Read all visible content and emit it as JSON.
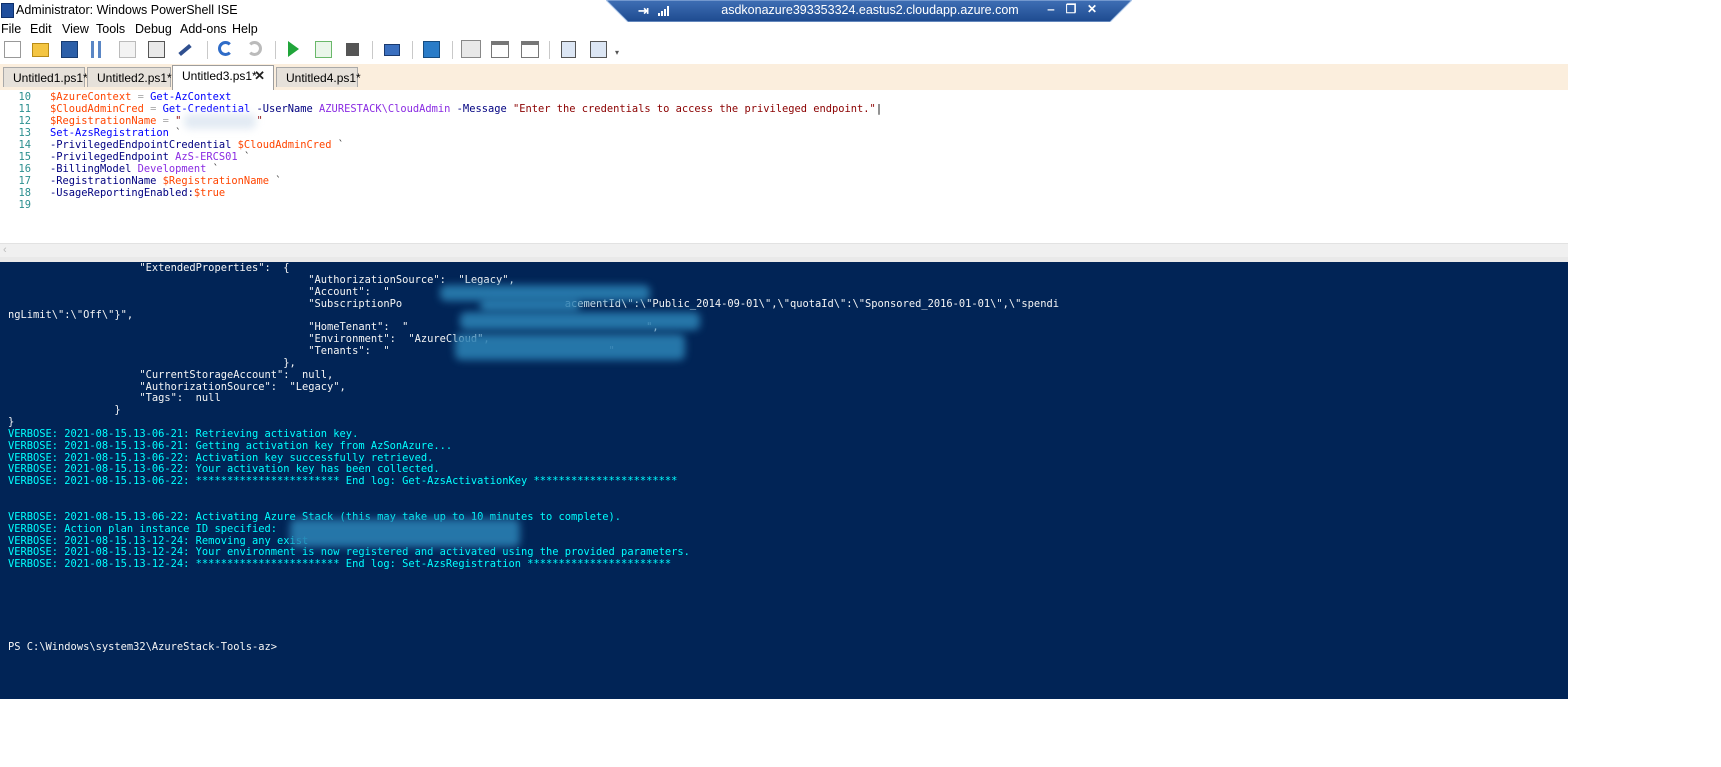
{
  "window": {
    "title": "Administrator: Windows PowerShell ISE"
  },
  "rdp_bar": {
    "host": "asdkonazure393353324.eastus2.cloudapp.azure.com",
    "pin_icon": "pin-icon",
    "signal_icon": "signal-strength-icon",
    "minimize_icon": "minimize-icon",
    "restore_icon": "restore-icon",
    "close_icon": "close-icon"
  },
  "menu": [
    "File",
    "Edit",
    "View",
    "Tools",
    "Debug",
    "Add-ons",
    "Help"
  ],
  "toolbar": {
    "icons": [
      "new-icon",
      "open-icon",
      "save-icon",
      "cut-icon",
      "copy-icon",
      "paste-icon",
      "clear-icon",
      "undo-icon",
      "redo-icon",
      "run-icon",
      "run-selection-icon",
      "stop-icon",
      "remote-powershell-icon",
      "powershell-icon",
      "show-script-pane-top-icon",
      "show-script-pane-right-icon",
      "show-script-pane-maximized-icon",
      "show-command-window-icon",
      "show-command-addon-icon",
      "toolbar-overflow-icon"
    ]
  },
  "tabs": [
    {
      "label": "Untitled1.ps1*",
      "active": false
    },
    {
      "label": "Untitled2.ps1*",
      "active": false
    },
    {
      "label": "Untitled3.ps1*",
      "active": true,
      "close": "✕"
    },
    {
      "label": "Untitled4.ps1*",
      "active": false
    }
  ],
  "editor": {
    "lines": [
      {
        "n": "10",
        "tokens": [
          [
            "var",
            "$AzureContext"
          ],
          [
            "op",
            " = "
          ],
          [
            "cmd",
            "Get-AzContext"
          ]
        ]
      },
      {
        "n": "11",
        "tokens": [
          [
            "var",
            "$CloudAdminCred"
          ],
          [
            "op",
            " = "
          ],
          [
            "cmd",
            "Get-Credential"
          ],
          [
            "param",
            " -UserName "
          ],
          [
            "plain",
            "AZURESTACK\\CloudAdmin"
          ],
          [
            "param",
            " -Message "
          ],
          [
            "str",
            "\"Enter the credentials to access the privileged endpoint.\""
          ],
          [
            "txt",
            "|"
          ]
        ]
      },
      {
        "n": "12",
        "tokens": [
          [
            "var",
            "$RegistrationName"
          ],
          [
            "op",
            " = "
          ],
          [
            "str",
            "\"            \""
          ]
        ]
      },
      {
        "n": "13",
        "tokens": [
          [
            "cmd",
            "Set-AzsRegistration"
          ],
          [
            "bt",
            " `"
          ]
        ]
      },
      {
        "n": "14",
        "tokens": [
          [
            "param",
            "-PrivilegedEndpointCredential "
          ],
          [
            "var",
            "$CloudAdminCred"
          ],
          [
            "bt",
            " `"
          ]
        ]
      },
      {
        "n": "15",
        "tokens": [
          [
            "param",
            "-PrivilegedEndpoint "
          ],
          [
            "plain",
            "AzS-ERCS01"
          ],
          [
            "bt",
            " `"
          ]
        ]
      },
      {
        "n": "16",
        "tokens": [
          [
            "param",
            "-BillingModel "
          ],
          [
            "plain",
            "Development"
          ],
          [
            "bt",
            " `"
          ]
        ]
      },
      {
        "n": "17",
        "tokens": [
          [
            "param",
            "-RegistrationName "
          ],
          [
            "var",
            "$RegistrationName"
          ],
          [
            "bt",
            " `"
          ]
        ]
      },
      {
        "n": "18",
        "tokens": [
          [
            "param",
            "-UsageReportingEnabled:"
          ],
          [
            "var",
            "$true"
          ]
        ]
      },
      {
        "n": "19",
        "tokens": []
      }
    ]
  },
  "console": {
    "lines": [
      {
        "text": "                     \"ExtendedProperties\":  {",
        "cls": "white"
      },
      {
        "text": "                                                \"AuthorizationSource\":  \"Legacy\",",
        "cls": "white"
      },
      {
        "text": "                                                \"Account\":  \"",
        "cls": "white"
      },
      {
        "text": "                                                \"SubscriptionPo                          acementId\\\":\\\"Public_2014-09-01\\\",\\\"quotaId\\\":\\\"Sponsored_2016-01-01\\\",\\\"spendi",
        "cls": "white"
      },
      {
        "text": "ngLimit\\\":\\\"Off\\\"}\",",
        "cls": "white"
      },
      {
        "text": "                                                \"HomeTenant\":  \"                                      \",",
        "cls": "white"
      },
      {
        "text": "                                                \"Environment\":  \"AzureCloud\",",
        "cls": "white"
      },
      {
        "text": "                                                \"Tenants\":  \"                                   \"",
        "cls": "white"
      },
      {
        "text": "                                            },",
        "cls": "white"
      },
      {
        "text": "                     \"CurrentStorageAccount\":  null,",
        "cls": "white"
      },
      {
        "text": "                     \"AuthorizationSource\":  \"Legacy\",",
        "cls": "white"
      },
      {
        "text": "                     \"Tags\":  null",
        "cls": "white"
      },
      {
        "text": "                 }",
        "cls": "white"
      },
      {
        "text": "}",
        "cls": "white"
      },
      {
        "text": "VERBOSE: 2021-08-15.13-06-21: Retrieving activation key.",
        "cls": "verbose"
      },
      {
        "text": "VERBOSE: 2021-08-15.13-06-21: Getting activation key from AzSonAzure...",
        "cls": "verbose"
      },
      {
        "text": "VERBOSE: 2021-08-15.13-06-22: Activation key successfully retrieved.",
        "cls": "verbose"
      },
      {
        "text": "VERBOSE: 2021-08-15.13-06-22: Your activation key has been collected.",
        "cls": "verbose"
      },
      {
        "text": "VERBOSE: 2021-08-15.13-06-22: *********************** End log: Get-AzsActivationKey ***********************",
        "cls": "verbose"
      },
      {
        "text": "",
        "cls": "verbose"
      },
      {
        "text": "",
        "cls": "verbose"
      },
      {
        "text": "VERBOSE: 2021-08-15.13-06-22: Activating Azure Stack (this may take up to 10 minutes to complete).",
        "cls": "verbose"
      },
      {
        "text": "VERBOSE: Action plan instance ID specified:",
        "cls": "verbose"
      },
      {
        "text": "VERBOSE: 2021-08-15.13-12-24: Removing any exist",
        "cls": "verbose"
      },
      {
        "text": "VERBOSE: 2021-08-15.13-12-24: Your environment is now registered and activated using the provided parameters.",
        "cls": "verbose"
      },
      {
        "text": "VERBOSE: 2021-08-15.13-12-24: *********************** End log: Set-AzsRegistration ***********************",
        "cls": "verbose"
      },
      {
        "text": "",
        "cls": "white"
      },
      {
        "text": "",
        "cls": "white"
      },
      {
        "text": "",
        "cls": "white"
      },
      {
        "text": "",
        "cls": "white"
      },
      {
        "text": "",
        "cls": "white"
      },
      {
        "text": "",
        "cls": "white"
      },
      {
        "text": "PS C:\\Windows\\system32\\AzureStack-Tools-az>",
        "cls": "white"
      }
    ]
  }
}
